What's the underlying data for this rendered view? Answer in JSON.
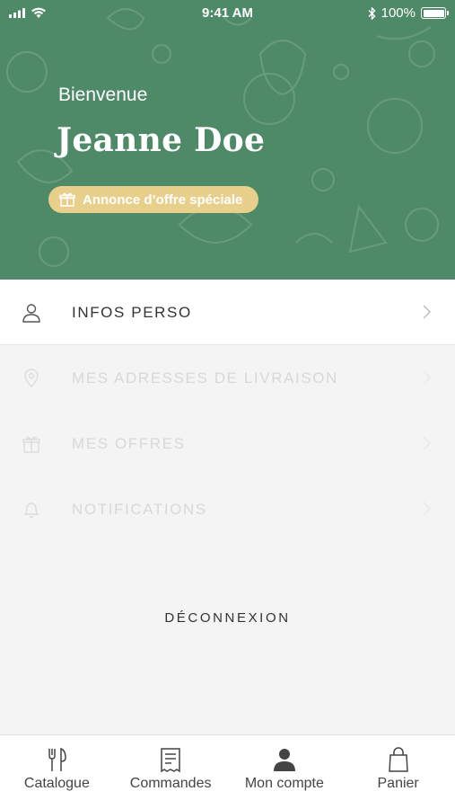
{
  "status_bar": {
    "time": "9:41 AM",
    "battery": "100%"
  },
  "header": {
    "welcome": "Bienvenue",
    "user_name": "Jeanne Doe",
    "promo_label": "Annonce d’offre spéciale"
  },
  "menu": {
    "items": [
      {
        "label": "INFOS PERSO",
        "icon": "user-icon"
      },
      {
        "label": "MES ADRESSES DE LIVRAISON",
        "icon": "location-pin-icon"
      },
      {
        "label": "MES OFFRES",
        "icon": "gift-icon"
      },
      {
        "label": "NOTIFICATIONS",
        "icon": "bell-icon"
      }
    ]
  },
  "logout_label": "DÉCONNEXION",
  "tabbar": {
    "tabs": [
      {
        "label": "Catalogue",
        "icon": "fork-knife-icon"
      },
      {
        "label": "Commandes",
        "icon": "receipt-icon"
      },
      {
        "label": "Mon compte",
        "icon": "user-filled-icon"
      },
      {
        "label": "Panier",
        "icon": "shopping-bag-icon"
      }
    ]
  },
  "colors": {
    "header_bg": "#4f8a68",
    "promo_bg": "#e8cf8b",
    "page_bg": "#f4f4f4"
  }
}
